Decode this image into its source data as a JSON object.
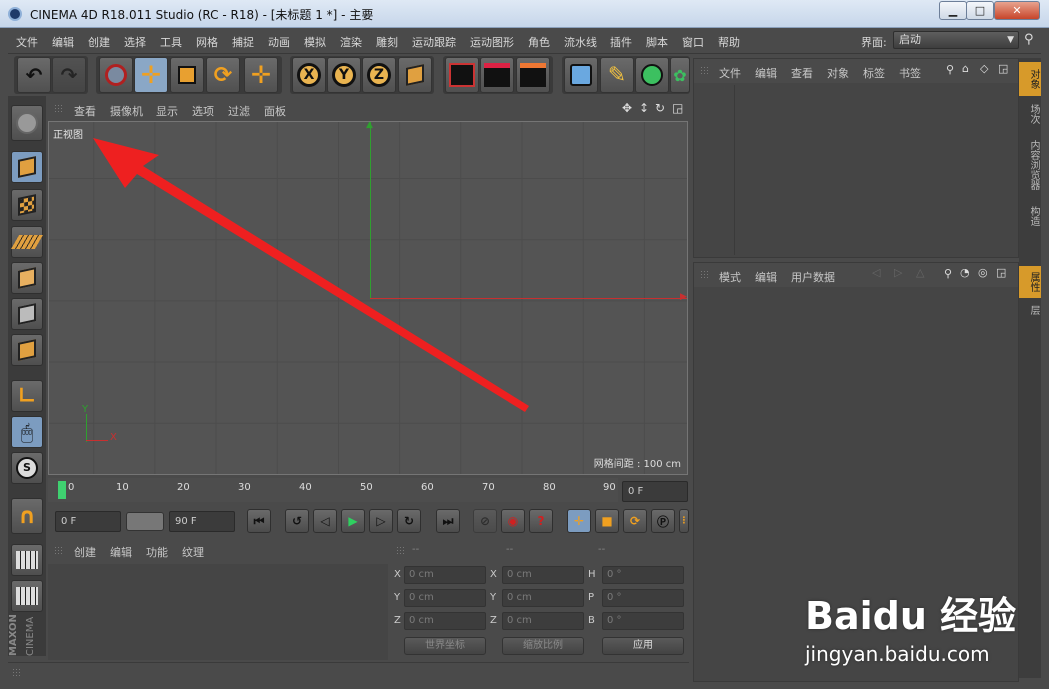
{
  "window": {
    "title": "CINEMA 4D R18.011 Studio (RC - R18) - [未标题 1 *] - 主要",
    "min": "▁",
    "max": "□",
    "close": "✕"
  },
  "menu": [
    "文件",
    "编辑",
    "创建",
    "选择",
    "工具",
    "网格",
    "捕捉",
    "动画",
    "模拟",
    "渲染",
    "雕刻",
    "运动跟踪",
    "运动图形",
    "角色",
    "流水线",
    "插件",
    "脚本",
    "窗口",
    "帮助"
  ],
  "layout": {
    "label": "界面:",
    "value": "启动"
  },
  "toolbar": {
    "axis_x": "X",
    "axis_y": "Y",
    "axis_z": "Z"
  },
  "viewport": {
    "menu": [
      "查看",
      "摄像机",
      "显示",
      "选项",
      "过滤",
      "面板"
    ],
    "view_name": "正视图",
    "grid_spacing": "网格间距 : 100 cm",
    "axis_y": "Y",
    "axis_x": "X"
  },
  "timeline": {
    "ticks": [
      "0",
      "10",
      "20",
      "30",
      "40",
      "50",
      "60",
      "70",
      "80",
      "90"
    ],
    "current": "0 F",
    "start": "0 F",
    "end": "90 F"
  },
  "objects_panel": {
    "menu": [
      "文件",
      "编辑",
      "查看",
      "对象",
      "标签",
      "书签"
    ]
  },
  "attributes_panel": {
    "menu": [
      "模式",
      "编辑",
      "用户数据"
    ]
  },
  "side_tabs_top": [
    "对象",
    "场次",
    "内容浏览器",
    "构造"
  ],
  "side_tabs_bottom": [
    "属性",
    "层"
  ],
  "material_panel": {
    "menu": [
      "创建",
      "编辑",
      "功能",
      "纹理"
    ]
  },
  "coords": {
    "headers": [
      "--",
      "--",
      "--"
    ],
    "rows": [
      {
        "a": "X",
        "av": "0 cm",
        "b": "X",
        "bv": "0 cm",
        "c": "H",
        "cv": "0 °"
      },
      {
        "a": "Y",
        "av": "0 cm",
        "b": "Y",
        "bv": "0 cm",
        "c": "P",
        "cv": "0 °"
      },
      {
        "a": "Z",
        "av": "0 cm",
        "b": "Z",
        "bv": "0 cm",
        "c": "B",
        "cv": "0 °"
      }
    ],
    "world": "世界坐标",
    "scale": "缩放比例",
    "apply": "应用"
  },
  "brand": {
    "maxon": "MAXON",
    "cinema": "CINEMA"
  },
  "watermark": {
    "text": "Baidu 经验",
    "url": "jingyan.baidu.com"
  }
}
